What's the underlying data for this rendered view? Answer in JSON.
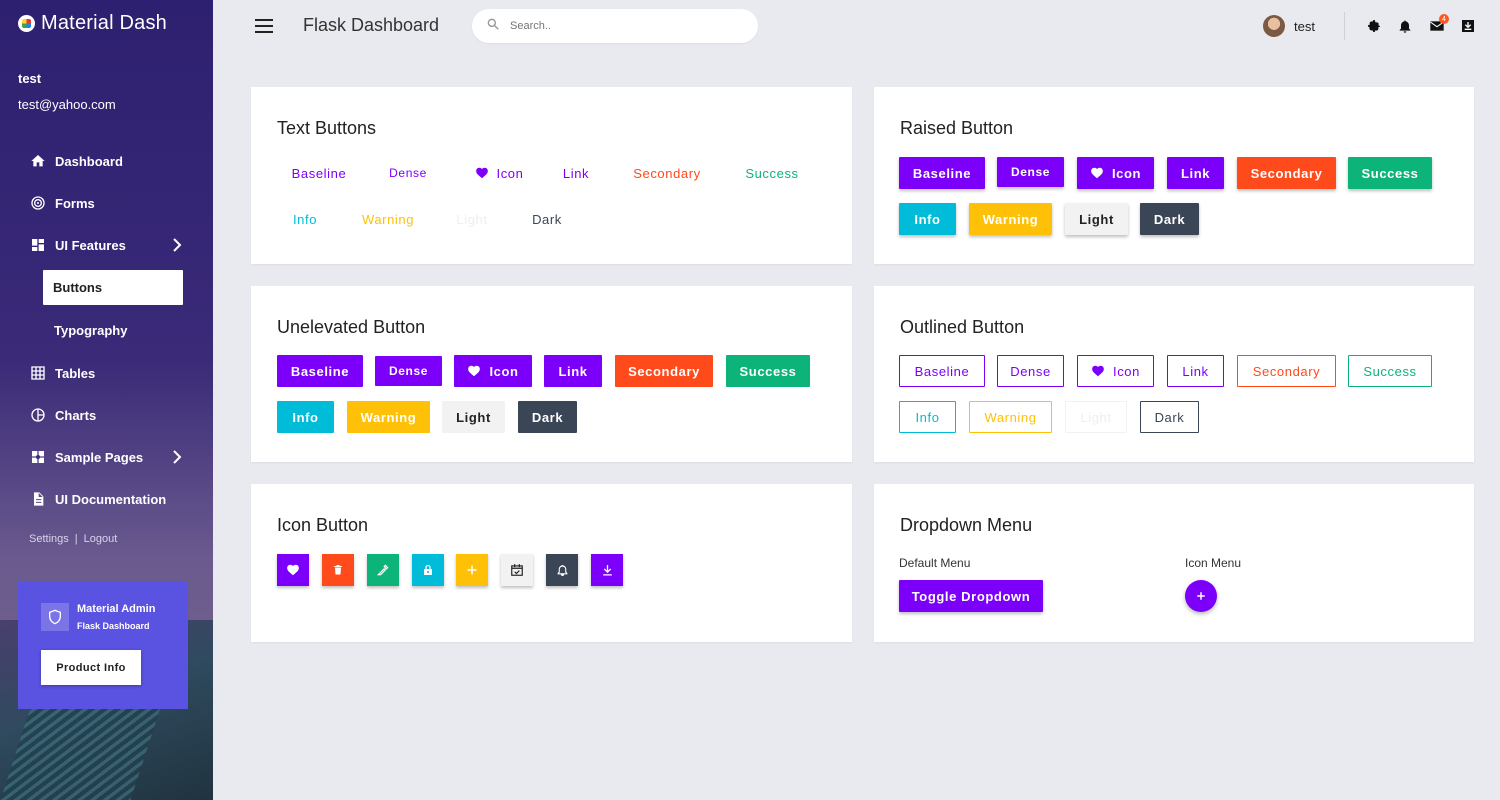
{
  "brand": {
    "name": "Material Dash"
  },
  "user": {
    "name": "test",
    "email": "test@yahoo.com"
  },
  "sidebar": {
    "items": [
      {
        "label": "Dashboard",
        "icon": "home-icon"
      },
      {
        "label": "Forms",
        "icon": "forms-icon"
      },
      {
        "label": "UI Features",
        "icon": "dashboard-grid-icon"
      },
      {
        "label": "Tables",
        "icon": "table-icon"
      },
      {
        "label": "Charts",
        "icon": "pie-chart-icon"
      },
      {
        "label": "Sample Pages",
        "icon": "pages-icon"
      },
      {
        "label": "UI Documentation",
        "icon": "document-icon"
      }
    ],
    "subitems": [
      {
        "label": "Buttons"
      },
      {
        "label": "Typography"
      }
    ],
    "settings_label": "Settings",
    "separator": "|",
    "logout_label": "Logout"
  },
  "promo": {
    "title": "Material Admin",
    "subtitle": "Flask Dashboard",
    "button": "Product Info"
  },
  "topbar": {
    "title": "Flask Dashboard",
    "search_placeholder": "Search..",
    "user_name": "test",
    "mail_badge": "4"
  },
  "colors": {
    "primary": "#7c00f9",
    "secondary": "#ff4a1c",
    "success": "#0db47a",
    "info": "#00bcd9",
    "warning": "#ffc107",
    "light": "#f2f2f2",
    "dark": "#3a4556"
  },
  "cards": {
    "text_buttons": {
      "title": "Text Buttons"
    },
    "raised": {
      "title": "Raised Button"
    },
    "unelevated": {
      "title": "Unelevated Button"
    },
    "outlined": {
      "title": "Outlined Button"
    },
    "icon_button": {
      "title": "Icon Button"
    },
    "dropdown": {
      "title": "Dropdown Menu",
      "default_label": "Default Menu",
      "icon_label": "Icon Menu",
      "toggle": "Toggle Dropdown"
    }
  },
  "buttons": {
    "baseline": "Baseline",
    "dense": "Dense",
    "icon": "Icon",
    "link": "Link",
    "secondary": "Secondary",
    "success": "Success",
    "info": "Info",
    "warning": "Warning",
    "light": "Light",
    "dark": "Dark"
  },
  "icon_buttons": [
    "heart-icon",
    "trash-icon",
    "eyedropper-icon",
    "lock-icon",
    "plus-icon",
    "calendar-check-icon",
    "bell-icon",
    "download-icon"
  ]
}
